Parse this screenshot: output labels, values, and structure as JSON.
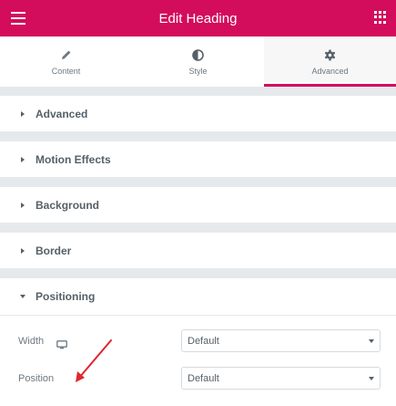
{
  "header": {
    "title": "Edit Heading",
    "menu_icon": "hamburger-menu-icon",
    "apps_icon": "grid-apps-icon",
    "color": "#d30c5c"
  },
  "tabs": [
    {
      "label": "Content",
      "icon": "pencil-icon",
      "active": false
    },
    {
      "label": "Style",
      "icon": "half-circle-icon",
      "active": false
    },
    {
      "label": "Advanced",
      "icon": "gear-icon",
      "active": true
    }
  ],
  "sections": [
    {
      "label": "Advanced",
      "expanded": false
    },
    {
      "label": "Motion Effects",
      "expanded": false
    },
    {
      "label": "Background",
      "expanded": false
    },
    {
      "label": "Border",
      "expanded": false
    },
    {
      "label": "Positioning",
      "expanded": true
    }
  ],
  "positioning": {
    "width": {
      "label": "Width",
      "icon": "desktop-monitor-icon",
      "value": "Default"
    },
    "position": {
      "label": "Position",
      "value": "Default"
    }
  },
  "annotation": {
    "icon": "red-arrow-icon",
    "color": "#e0262e"
  }
}
